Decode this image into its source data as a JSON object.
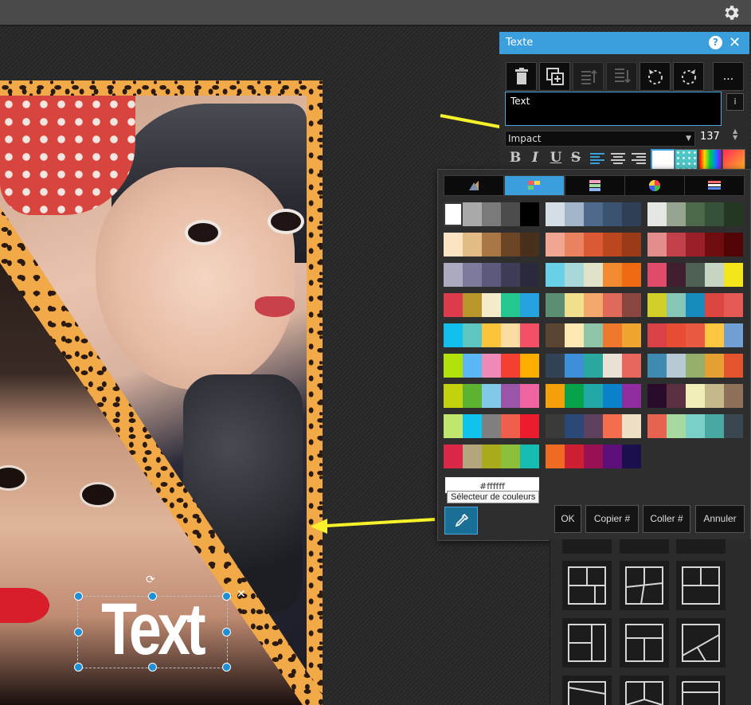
{
  "app": {
    "settings_icon": "gear-icon"
  },
  "canvas": {
    "text_layer": "Text"
  },
  "text_panel": {
    "title": "Texte",
    "help_label": "?",
    "close_label": "✕",
    "toolbar": {
      "delete_icon": "trash-icon",
      "duplicate_icon": "duplicate-icon",
      "bring_forward_icon": "bring-forward-icon",
      "send_backward_icon": "send-backward-icon",
      "rotate_left_icon": "rotate-left-icon",
      "rotate_right_icon": "rotate-right-icon",
      "more_label": "..."
    },
    "text_input_value": "Text",
    "info_label": "i",
    "font": "Impact",
    "font_size": "137",
    "format": {
      "bold": "B",
      "italic": "I",
      "underline": "U",
      "strike": "S"
    },
    "fill_color": "#ffffff"
  },
  "color_popup": {
    "tabs": [
      {
        "icon": "swatches-icon"
      },
      {
        "icon": "palette-grid-icon",
        "active": true
      },
      {
        "icon": "gradient-bars-icon"
      },
      {
        "icon": "color-wheel-icon"
      },
      {
        "icon": "color-stripes-icon"
      }
    ],
    "palettes": [
      [
        "#ffffff",
        "#a9a9a9",
        "#7a7a7a",
        "#4c4c4c",
        "#000000"
      ],
      [
        "#d5dde5",
        "#a3b5c8",
        "#4d6a8c",
        "#3b5270",
        "#2f3f56"
      ],
      [
        "#e4e7e2",
        "#97a590",
        "#4c6a49",
        "#35513a",
        "#243722"
      ],
      [
        "#fbe3c4",
        "#e2bb85",
        "#a97745",
        "#6c4526",
        "#49301d"
      ],
      [
        "#f1a693",
        "#e9835f",
        "#db5a35",
        "#bb4721",
        "#9a3a19"
      ],
      [
        "#e38c8c",
        "#c2404a",
        "#9b1f28",
        "#6e0c0f",
        "#500406"
      ],
      [
        "#abaac0",
        "#7d7a9d",
        "#5c5a7c",
        "#3e3d57",
        "#2a2a3d"
      ],
      [
        "#6ad0e7",
        "#a8d9d8",
        "#e2e2c8",
        "#f28a30",
        "#ef6a12"
      ],
      [
        "#e04b6a",
        "#3f1f2e",
        "#4f6055",
        "#c7d6c4",
        "#f4e61b"
      ],
      [
        "#dd3a4b",
        "#b9962a",
        "#f4ebcb",
        "#22c890",
        "#25a3e0"
      ],
      [
        "#5c8e73",
        "#f0e08e",
        "#f3a86c",
        "#e06a5a",
        "#8a4540"
      ],
      [
        "#d2cf28",
        "#86c6b7",
        "#168bc0",
        "#dd4540",
        "#e55a55"
      ],
      [
        "#12c0ee",
        "#5dc6c1",
        "#fcc43b",
        "#fbdca3",
        "#f34f65"
      ],
      [
        "#5c4432",
        "#fde7b3",
        "#8dc5a6",
        "#f0782c",
        "#f0a530"
      ],
      [
        "#d94147",
        "#e84d33",
        "#ea5941",
        "#fcc640",
        "#71a0d6"
      ],
      [
        "#b1e20b",
        "#5bb8f5",
        "#f08ab8",
        "#f53f32",
        "#fbae00"
      ],
      [
        "#334257",
        "#3d8fd9",
        "#2ba8a0",
        "#e9e2d4",
        "#e7665e"
      ],
      [
        "#3f8ab0",
        "#b6c9d5",
        "#95af6a",
        "#e4a132",
        "#e3542e"
      ],
      [
        "#c2d30e",
        "#5ab432",
        "#80c9e8",
        "#9a55a8",
        "#ef64a0"
      ],
      [
        "#f6a009",
        "#07a24a",
        "#21a8a7",
        "#0a82c9",
        "#912e9f"
      ],
      [
        "#2a0b2b",
        "#5b3041",
        "#f1edb6",
        "#c5b98b",
        "#8d7159"
      ],
      [
        "#c1e66d",
        "#0fc3ed",
        "#7f7f7f",
        "#f05f4b",
        "#ec1c2e"
      ],
      [
        "#3a3a3a",
        "#2a4878",
        "#60415d",
        "#f66c4e",
        "#ede0c4"
      ],
      [
        "#e7624f",
        "#a6d9a0",
        "#7bcfc9",
        "#4aa8a3",
        "#3a4650"
      ],
      [
        "#dc2848",
        "#b3a57d",
        "#a9ab1a",
        "#8cbf3b",
        "#14bcb1"
      ],
      [
        "#ef6a22",
        "#cf1f33",
        "#9a1055",
        "#5d0f7a",
        "#1b0f4d"
      ]
    ],
    "hex_value": "#ffffff",
    "tooltip": "Sélecteur de couleurs",
    "picker_icon": "eyedropper-icon",
    "ok_label": "OK",
    "copy_label": "Copier #",
    "paste_label": "Coller #",
    "cancel_label": "Annuler"
  }
}
